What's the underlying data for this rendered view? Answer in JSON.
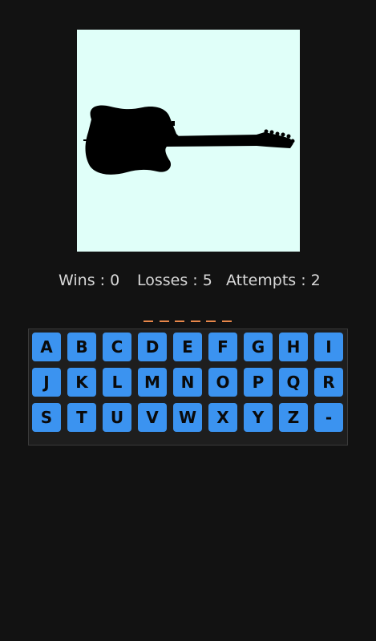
{
  "image": {
    "subject_icon": "guitar-silhouette-icon",
    "background_color": "#e0fff9"
  },
  "stats": {
    "wins_label": "Wins : 0",
    "losses_label": "Losses : 5",
    "attempts_label": "Attempts : 2"
  },
  "word": {
    "blank_count": 6,
    "dash_color": "#e8874a"
  },
  "keyboard": {
    "key_color": "#3b93f0",
    "rows": [
      [
        "A",
        "B",
        "C",
        "D",
        "E",
        "F",
        "G",
        "H",
        "I"
      ],
      [
        "J",
        "K",
        "L",
        "M",
        "N",
        "O",
        "P",
        "Q",
        "R"
      ],
      [
        "S",
        "T",
        "U",
        "V",
        "W",
        "X",
        "Y",
        "Z",
        "-"
      ]
    ]
  }
}
